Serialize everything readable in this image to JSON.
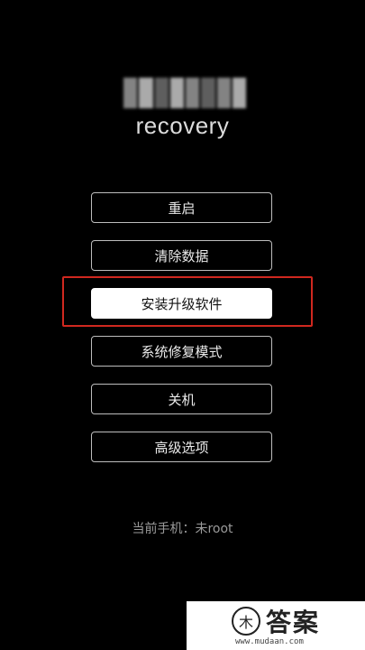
{
  "header": {
    "title": "recovery"
  },
  "menu": {
    "items": [
      {
        "label": "重启"
      },
      {
        "label": "清除数据"
      },
      {
        "label": "安装升级软件",
        "selected": true
      },
      {
        "label": "系统修复模式"
      },
      {
        "label": "关机"
      },
      {
        "label": "高级选项"
      }
    ]
  },
  "status": {
    "text": "当前手机：未root"
  },
  "watermark": {
    "logo_glyph": "木",
    "text": "答案",
    "url": "www.mudaan.com"
  },
  "colors": {
    "background": "#000000",
    "highlight_border": "#d0281f",
    "selected_button": "#ffffff"
  }
}
